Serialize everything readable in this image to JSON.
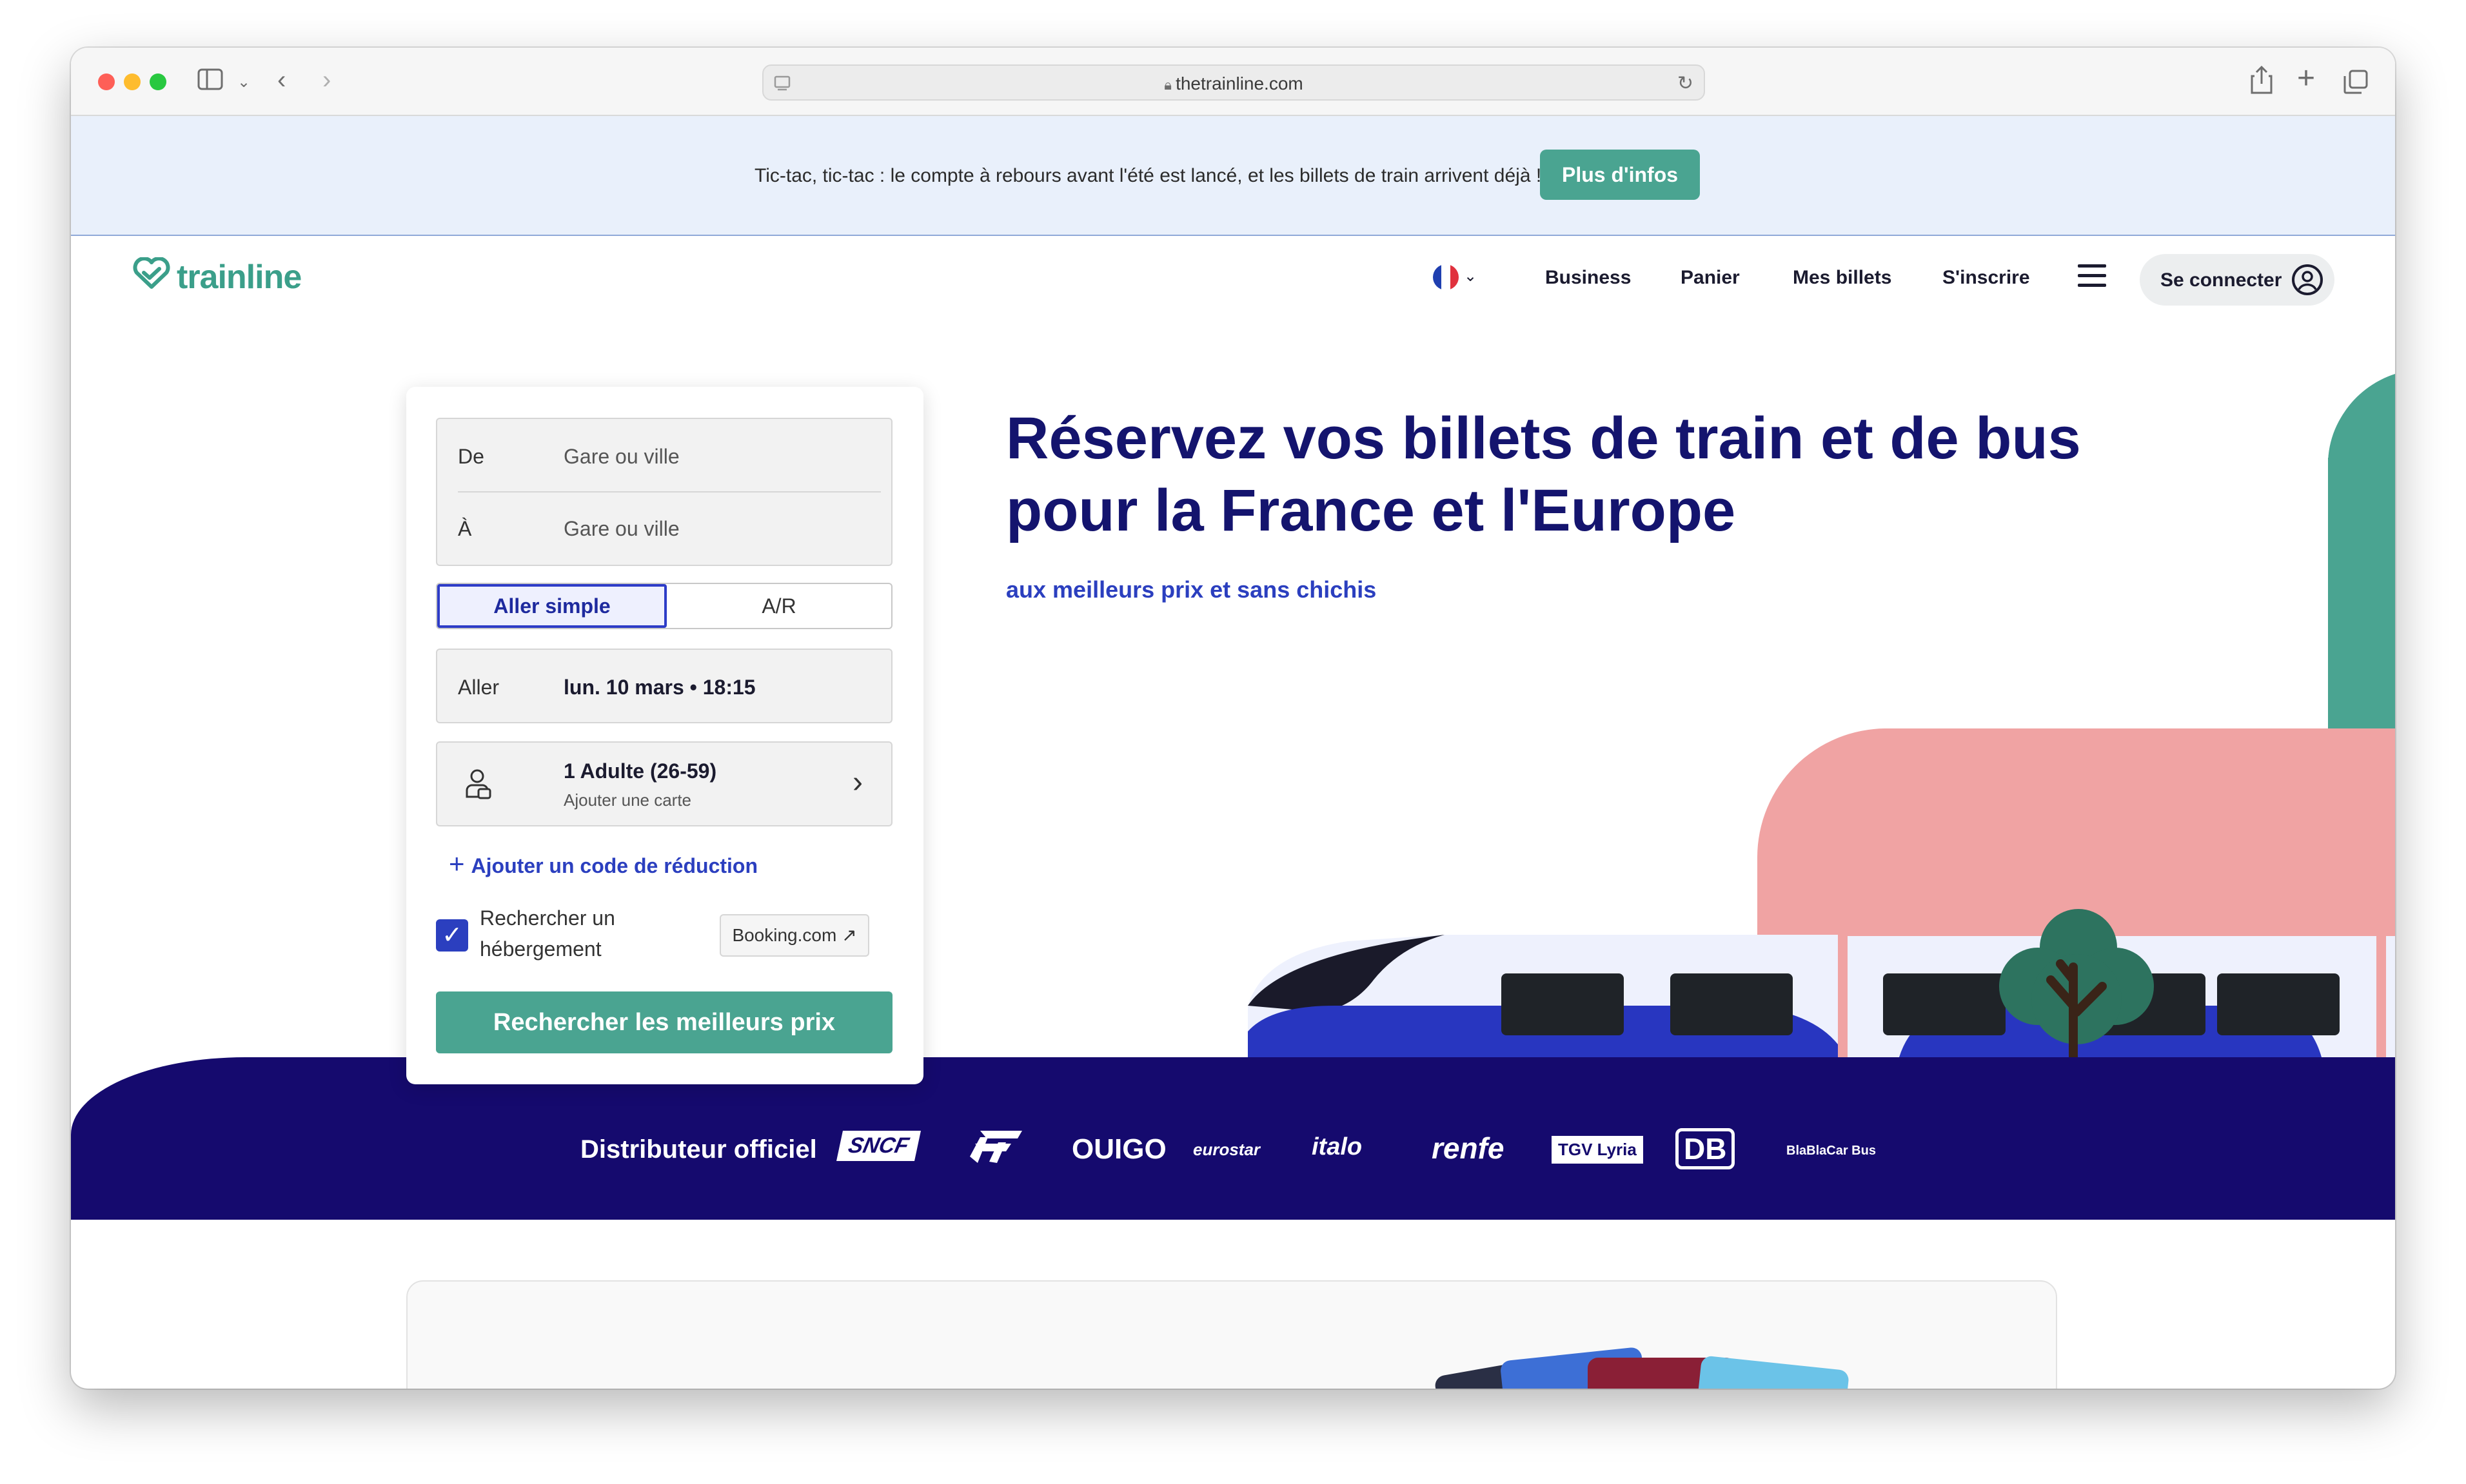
{
  "browser": {
    "url": "thetrainline.com"
  },
  "banner": {
    "text": "Tic-tac, tic-tac : le compte à rebours avant l'été est lancé, et les billets de train arrivent déjà !",
    "button": "Plus d'infos"
  },
  "header": {
    "logo": "trainline",
    "nav": [
      "Business",
      "Panier",
      "Mes billets",
      "S'inscrire"
    ],
    "login": "Se connecter"
  },
  "hero": {
    "title_line1": "Réservez vos billets de train et de bus",
    "title_line2": "pour la France et l'Europe",
    "subtitle": "aux meilleurs prix et sans chichis"
  },
  "search": {
    "from_label": "De",
    "from_placeholder": "Gare ou ville",
    "to_label": "À",
    "to_placeholder": "Gare ou ville",
    "trip_types": [
      "Aller simple",
      "A/R"
    ],
    "date_label": "Aller",
    "date_value": "lun. 10 mars • 18:15",
    "passengers": "1 Adulte (26-59)",
    "add_card": "Ajouter une carte",
    "discount_link": "Ajouter un code de réduction",
    "accommodation_label": "Rechercher un hébergement",
    "booking_badge": "Booking.com ↗",
    "submit": "Rechercher les meilleurs prix"
  },
  "partners": {
    "label": "Distributeur officiel",
    "logos": [
      "SNCF",
      "Trenitalia",
      "OUIGO",
      "eurostar",
      "italo",
      "renfe",
      "TGV Lyria",
      "DB",
      "BlaBlaCar Bus"
    ]
  },
  "colors": {
    "brand_green": "#4aa491",
    "navy": "#150a6e",
    "title_navy": "#14146e",
    "link_blue": "#2b3fbf",
    "pink": "#f0a3a3"
  }
}
